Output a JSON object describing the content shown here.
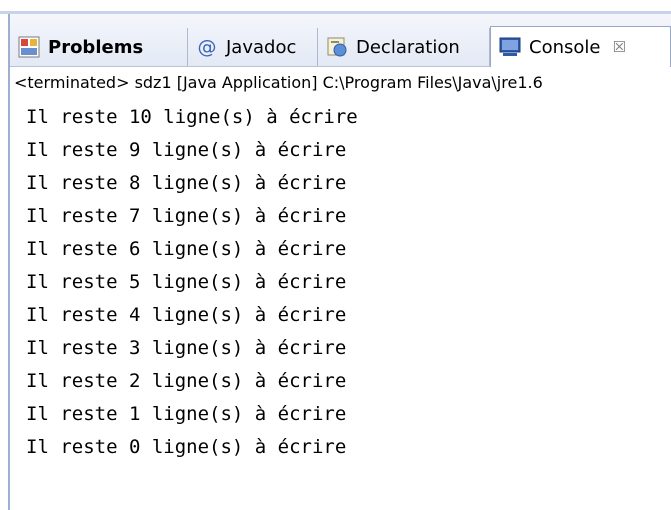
{
  "tabs": [
    {
      "label": "Problems",
      "icon": "problems-icon"
    },
    {
      "label": "Javadoc",
      "icon": "javadoc-at-icon"
    },
    {
      "label": "Declaration",
      "icon": "declaration-icon"
    },
    {
      "label": "Console",
      "icon": "console-icon",
      "active": true,
      "close": "☒"
    }
  ],
  "status": "<terminated> sdz1 [Java Application] C:\\Program Files\\Java\\jre1.6",
  "console_lines": [
    "Il reste 10 ligne(s) à écrire",
    "Il reste 9 ligne(s) à écrire",
    "Il reste 8 ligne(s) à écrire",
    "Il reste 7 ligne(s) à écrire",
    "Il reste 6 ligne(s) à écrire",
    "Il reste 5 ligne(s) à écrire",
    "Il reste 4 ligne(s) à écrire",
    "Il reste 3 ligne(s) à écrire",
    "Il reste 2 ligne(s) à écrire",
    "Il reste 1 ligne(s) à écrire",
    "Il reste 0 ligne(s) à écrire"
  ],
  "colors": {
    "accent": "#c7d3ea",
    "frame": "#9fb0cf"
  }
}
